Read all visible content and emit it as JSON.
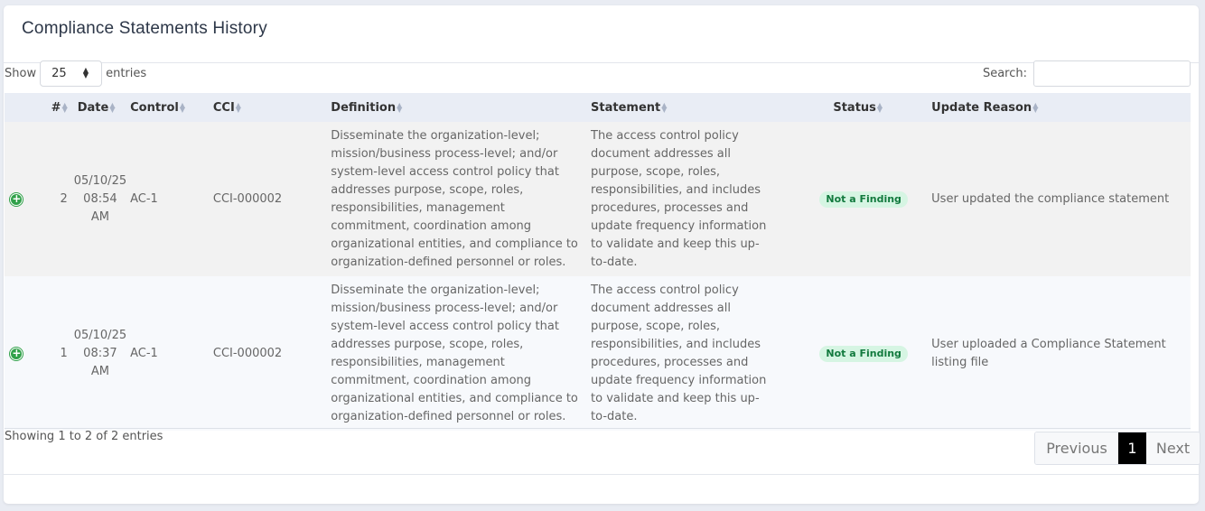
{
  "card": {
    "title": "Compliance Statements History"
  },
  "length": {
    "show_label": "Show",
    "value": "25",
    "entries_label": "entries"
  },
  "search": {
    "label": "Search:",
    "value": ""
  },
  "table": {
    "headers": [
      "#",
      "Date",
      "Control",
      "CCI",
      "Definition",
      "Statement",
      "Status",
      "Update Reason"
    ],
    "rows": [
      {
        "num": "2",
        "date": "05/10/25 08:54 AM",
        "control": "AC-1",
        "cci": "CCI-000002",
        "definition": "Disseminate the organization-level; mission/business process-level; and/or system-level access control policy that addresses purpose, scope, roles, responsibilities, management commitment, coordination among organizational entities, and compliance to organization-defined personnel or roles.",
        "statement": "The access control policy document addresses all purpose, scope, roles, responsibilities, and includes procedures, processes and update frequency information to validate and keep this up-to-date.",
        "status": "Not a Finding",
        "reason": "User updated the compliance statement"
      },
      {
        "num": "1",
        "date": "05/10/25 08:37 AM",
        "control": "AC-1",
        "cci": "CCI-000002",
        "definition": "Disseminate the organization-level; mission/business process-level; and/or system-level access control policy that addresses purpose, scope, roles, responsibilities, management commitment, coordination among organizational entities, and compliance to organization-defined personnel or roles.",
        "statement": "The access control policy document addresses all purpose, scope, roles, responsibilities, and includes procedures, processes and update frequency information to validate and keep this up-to-date.",
        "status": "Not a Finding",
        "reason": "User uploaded a Compliance Statement listing file"
      }
    ]
  },
  "footer": {
    "info": "Showing 1 to 2 of 2 entries"
  },
  "pagination": {
    "previous": "Previous",
    "current": "1",
    "next": "Next"
  },
  "colors": {
    "status_bg": "#d6f5e3",
    "status_text": "#127a3e",
    "expand_icon": "#31a14a",
    "active_page": "#000000"
  }
}
